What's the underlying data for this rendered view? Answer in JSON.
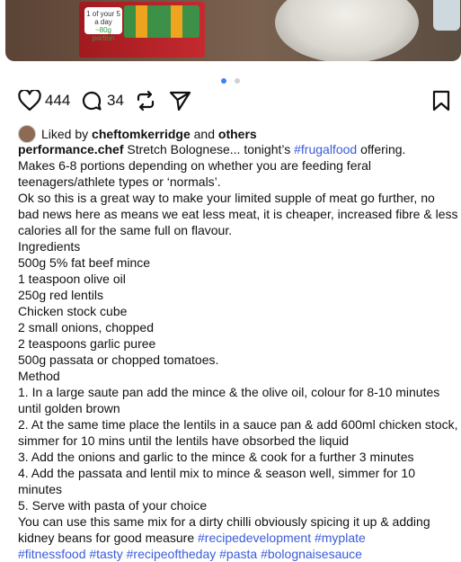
{
  "post": {
    "likes": "444",
    "comments": "34",
    "liked_by_prefix": "Liked by",
    "liked_by_user": "cheftomkerridge",
    "liked_by_and": "and",
    "liked_by_others": "others",
    "author": "performance.chef",
    "caption_intro": "Stretch Bolognese... tonight’s",
    "caption_tag1": "#frugalfood",
    "caption_intro_end": "offering.",
    "lines": [
      "Makes 6-8 portions depending on whether you are feeding feral teenagers/athlete types or ‘normals’.",
      "Ok so this is a great way to make your limited supple of meat go further, no bad news here as means we eat less meat, it is cheaper, increased fibre & less calories all for the same full on flavour.",
      "Ingredients",
      "500g 5% fat beef mince",
      "1 teaspoon olive oil",
      "250g red lentils",
      "Chicken stock cube",
      "2 small onions, chopped",
      "2 teaspoons garlic puree",
      "500g passata or chopped tomatoes.",
      "Method",
      "1. In a large saute pan add the mince & the olive oil, colour for 8-10 minutes until golden brown",
      "2. At the same time place the lentils in a sauce pan & add 600ml chicken stock, simmer for 10 mins until the lentils have obsorbed the liquid",
      "3. Add the onions and garlic to the mince & cook for a further 3 minutes",
      "4. Add the passata and lentil mix to mince & season well, simmer for 10 minutes",
      "5. Serve with pasta of your choice"
    ],
    "last_line_text": "You can use this same mix for a dirty chilli obviously spicing it up & adding kidney beans for good measure",
    "hashtags_line1": "#recipedevelopment #myplate",
    "hashtags_line2": "#fitnessfood #tasty #recipeoftheday #pasta #bolognaisesauce"
  },
  "photo": {
    "card_text": "1 of your 5 a day",
    "card_sub": "~80g portion"
  },
  "icons": [
    "heart-icon",
    "comment-icon",
    "repost-icon",
    "share-icon",
    "bookmark-icon"
  ],
  "colors": {
    "hashtag": "#3b5bdb",
    "dot_active": "#3b82f6"
  }
}
